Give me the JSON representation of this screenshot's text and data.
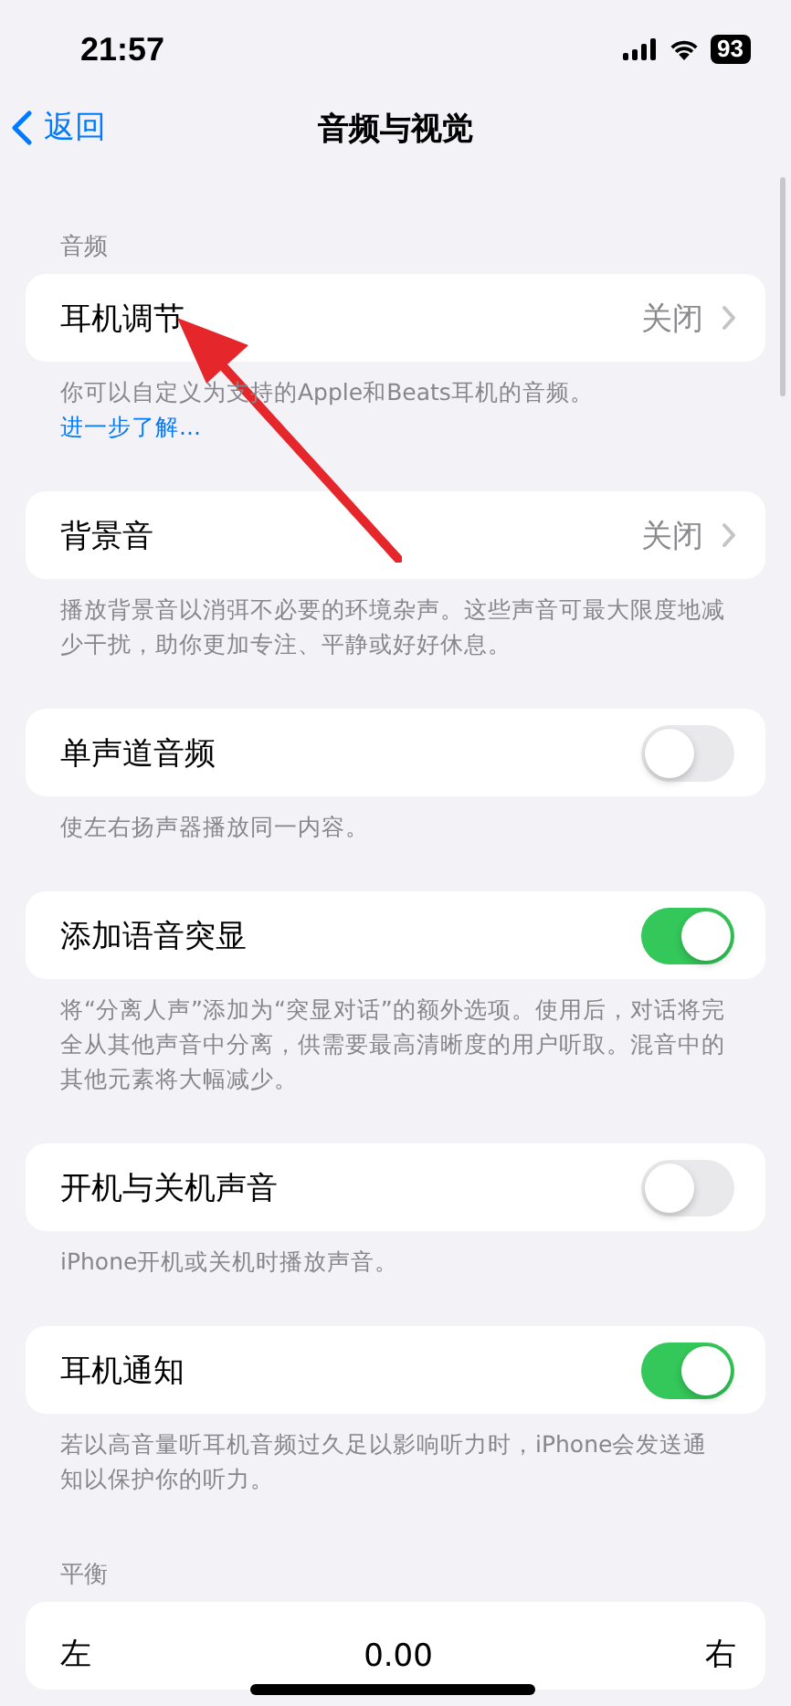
{
  "status_bar": {
    "time": "21:57",
    "battery": "93"
  },
  "nav": {
    "back": "返回",
    "title": "音频与视觉"
  },
  "sections": [
    {
      "header": "音频",
      "rows": [
        {
          "kind": "link",
          "label": "耳机调节",
          "value": "关闭"
        }
      ],
      "footer": {
        "text": "你可以自定义为支持的Apple和Beats耳机的音频。",
        "link": "进一步了解..."
      }
    },
    {
      "rows": [
        {
          "kind": "link",
          "label": "背景音",
          "value": "关闭"
        }
      ],
      "footer": {
        "text": "播放背景音以消弭不必要的环境杂声。这些声音可最大限度地减少干扰，助你更加专注、平静或好好休息。"
      }
    },
    {
      "rows": [
        {
          "kind": "toggle",
          "label": "单声道音频",
          "on": false
        }
      ],
      "footer": {
        "text": "使左右扬声器播放同一内容。"
      }
    },
    {
      "rows": [
        {
          "kind": "toggle",
          "label": "添加语音突显",
          "on": true
        }
      ],
      "footer": {
        "text": "将“分离人声”添加为“突显对话”的额外选项。使用后，对话将完全从其他声音中分离，供需要最高清晰度的用户听取。混音中的其他元素将大幅减少。"
      }
    },
    {
      "rows": [
        {
          "kind": "toggle",
          "label": "开机与关机声音",
          "on": false
        }
      ],
      "footer": {
        "text": "iPhone开机或关机时播放声音。"
      }
    },
    {
      "rows": [
        {
          "kind": "toggle",
          "label": "耳机通知",
          "on": true
        }
      ],
      "footer": {
        "text": "若以高音量听耳机音频过久足以影响听力时，iPhone会发送通知以保护你的听力。"
      }
    },
    {
      "header": "平衡",
      "rows": [
        {
          "kind": "balance",
          "left": "左",
          "value": "0.00",
          "right": "右"
        }
      ]
    }
  ]
}
